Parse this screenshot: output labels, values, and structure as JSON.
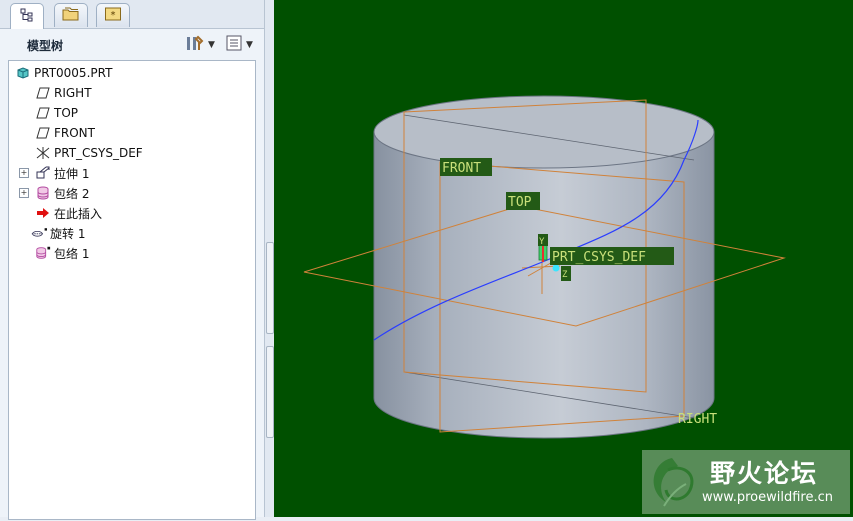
{
  "navigator": {
    "tabs": [
      {
        "name": "model-tree-tab",
        "active": true
      },
      {
        "name": "folder-browser-tab",
        "active": false
      },
      {
        "name": "favorites-tab",
        "active": false
      }
    ],
    "title": "模型树"
  },
  "tree": {
    "items": [
      {
        "label": "PRT0005.PRT",
        "icon": "part-icon",
        "expandable": false
      },
      {
        "label": "RIGHT",
        "icon": "datum-plane-icon",
        "expandable": false
      },
      {
        "label": "TOP",
        "icon": "datum-plane-icon",
        "expandable": false
      },
      {
        "label": "FRONT",
        "icon": "datum-plane-icon",
        "expandable": false
      },
      {
        "label": "PRT_CSYS_DEF",
        "icon": "csys-icon",
        "expandable": false
      },
      {
        "label": "拉伸 1",
        "icon": "extrude-icon",
        "expandable": true
      },
      {
        "label": "包络 2",
        "icon": "wrap-icon",
        "expandable": true
      },
      {
        "label": "在此插入",
        "icon": "insert-here-arrow-icon",
        "expandable": false
      },
      {
        "label": "旋转 1",
        "icon": "revolve-icon",
        "expandable": false
      },
      {
        "label": "包络 1",
        "icon": "wrap-icon",
        "expandable": false
      }
    ]
  },
  "viewport": {
    "background": "#005000",
    "datum_labels": {
      "front": "FRONT",
      "top": "TOP",
      "csys": "PRT_CSYS_DEF",
      "right": "RIGHT",
      "axis_y": "Y",
      "axis_z": "Z"
    }
  },
  "watermark": {
    "title": "野火论坛",
    "url": "www.proewildfire.cn"
  },
  "colors": {
    "datum_plane": "#d0823a",
    "curve": "#2a3dff",
    "label_bg": "#235a16",
    "label_text": "#c9e07a"
  }
}
